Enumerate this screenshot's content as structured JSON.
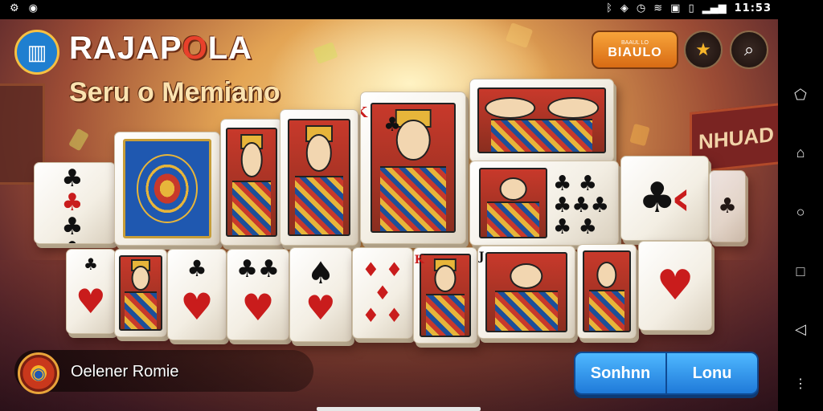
{
  "status_bar": {
    "left_icons": [
      "settings-icon",
      "cast-icon"
    ],
    "right_icons": [
      "bluetooth-icon",
      "location-icon",
      "alarm-icon",
      "wifi-icon",
      "nfc-icon",
      "vibrate-icon",
      "signal-icon"
    ],
    "time": "11:53"
  },
  "header": {
    "title_part1": "RAJAP",
    "title_part2": "O",
    "title_part3": "LA",
    "subtitle": "Seru o Memiano",
    "top_button_small": "BAAUL LO",
    "top_button_label": "BIAULO"
  },
  "icons": {
    "star": "★",
    "search": "⌕"
  },
  "tiles_row1": [
    {
      "kind": "pips",
      "suit": "♣",
      "color": "blk",
      "corner": "♣"
    },
    {
      "kind": "back"
    },
    {
      "kind": "face",
      "corner": ""
    },
    {
      "kind": "face",
      "corner": ""
    },
    {
      "kind": "face",
      "corner": "K",
      "suit": "♣"
    },
    {
      "kind": "face",
      "corner": ""
    },
    {
      "kind": "pips",
      "suit": "♣",
      "color": "blk"
    },
    {
      "kind": "big",
      "suit": "♣",
      "color": "blk"
    },
    {
      "kind": "pips",
      "suit": "♣",
      "color": "blk"
    }
  ],
  "tiles_row2": [
    {
      "kind": "pip",
      "suit": "♥",
      "color": "red",
      "corner": "♣"
    },
    {
      "kind": "face",
      "corner": ""
    },
    {
      "kind": "pip",
      "suit": "♥",
      "color": "red",
      "corner": "♣"
    },
    {
      "kind": "pip",
      "suit": "♥",
      "color": "red",
      "corner": "♣"
    },
    {
      "kind": "pip",
      "suit": "♠",
      "color": "blk",
      "corner": "♥"
    },
    {
      "kind": "pip",
      "suit": "♦",
      "color": "red",
      "corner": "♦"
    },
    {
      "kind": "face",
      "corner": "K"
    },
    {
      "kind": "face",
      "corner": "J"
    },
    {
      "kind": "face",
      "corner": ""
    },
    {
      "kind": "pip",
      "suit": "♥",
      "color": "red",
      "corner": ""
    }
  ],
  "bottom": {
    "player_name": "Oelener Romie",
    "button_left": "Sonhnn",
    "button_right": "Lonu"
  },
  "side_sign": "NHUAD"
}
